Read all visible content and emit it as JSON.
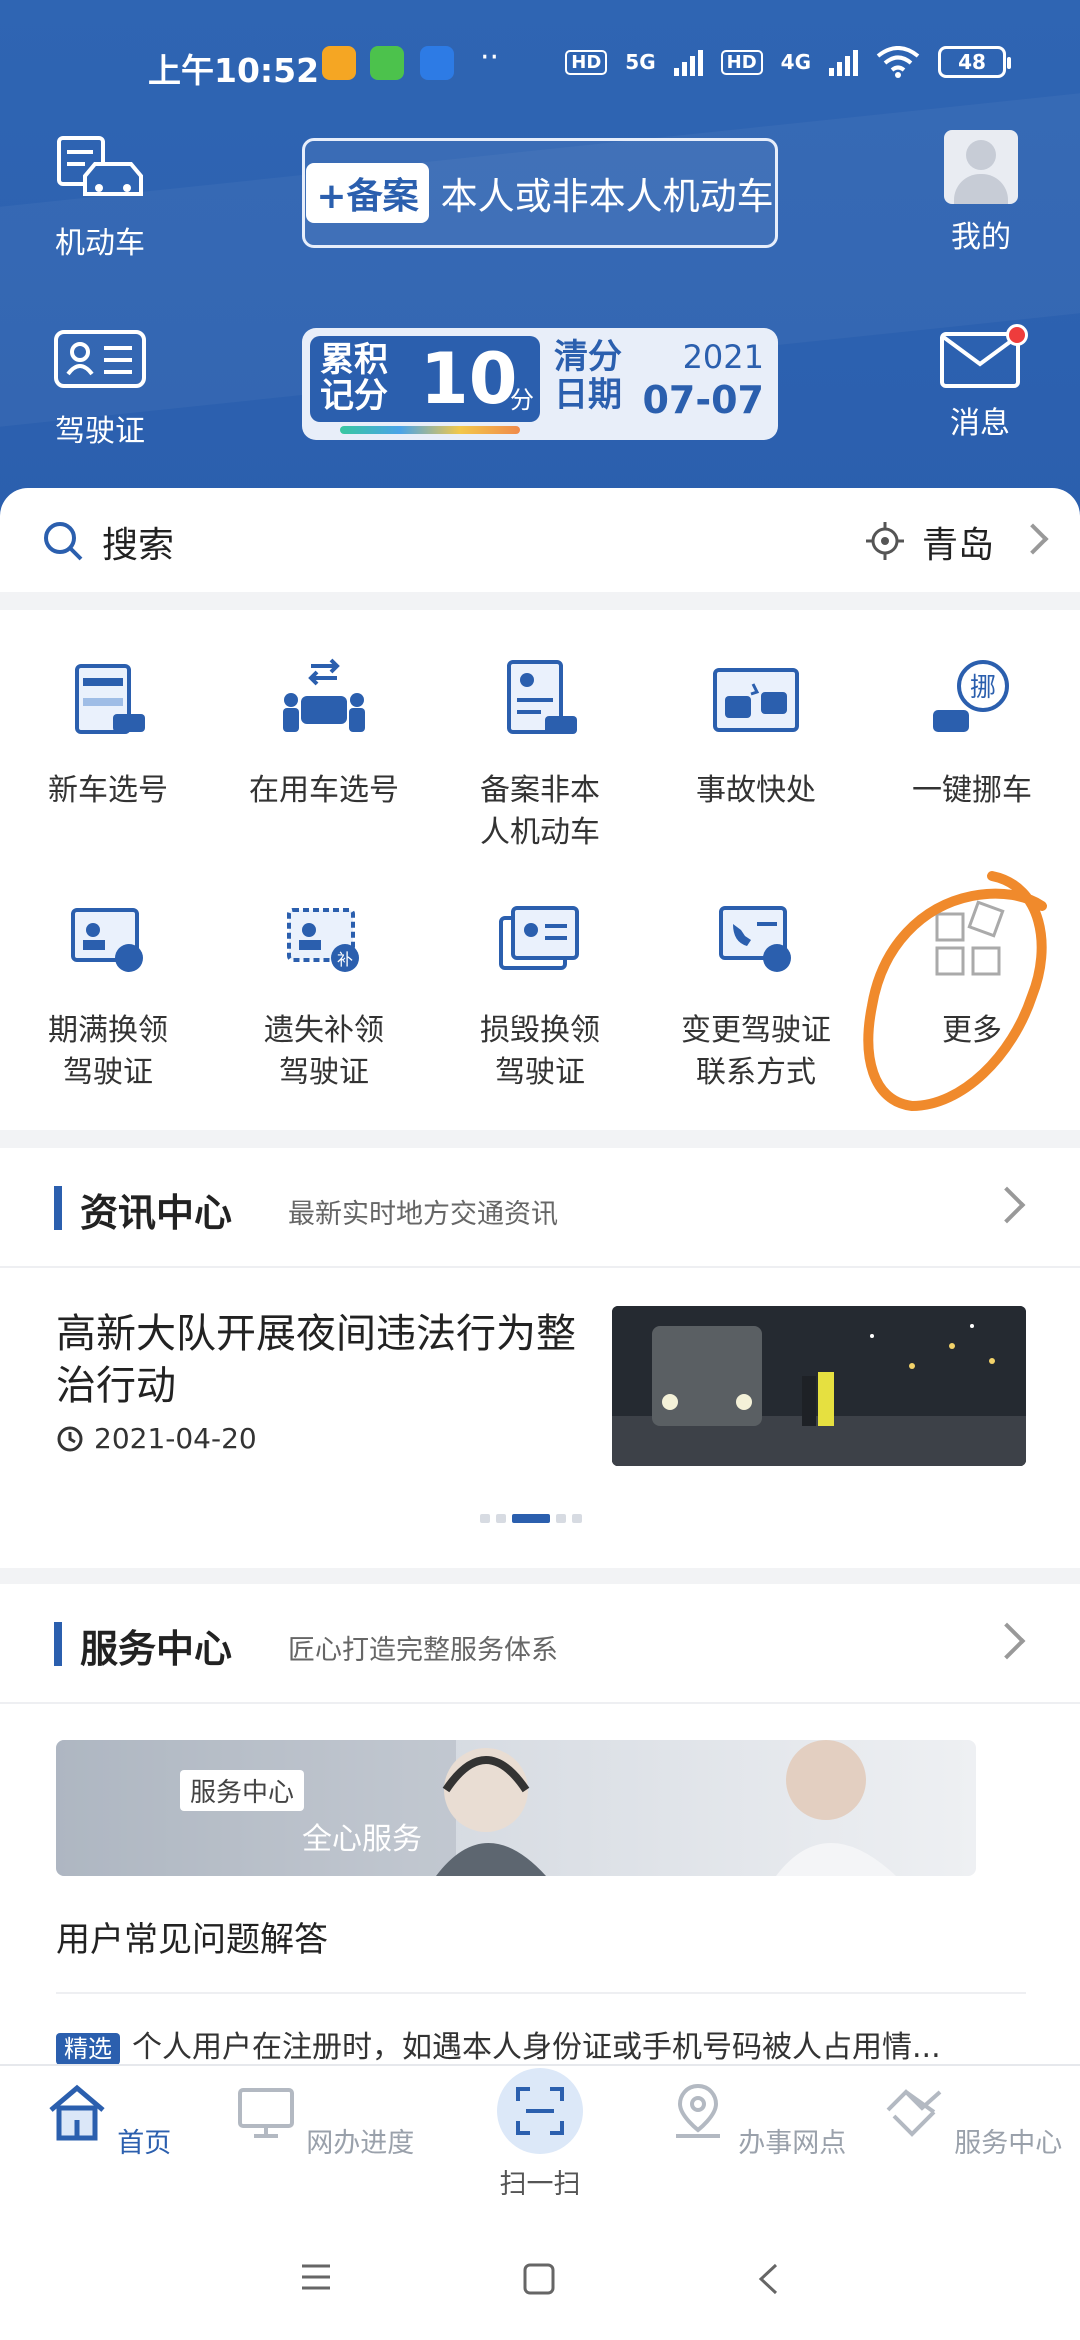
{
  "status_bar": {
    "time": "上午10:52",
    "network1": "5G",
    "network2": "4G",
    "hd1": "HD",
    "hd2": "HD",
    "battery": "48"
  },
  "header": {
    "vehicle_label": "机动车",
    "license_label": "驾驶证",
    "profile_label": "我的",
    "message_label": "消息",
    "register_tag": "+备案",
    "register_text": "本人或非本人机动车",
    "points_label": "累积记分",
    "points_value": "10",
    "points_unit": "分",
    "clear_label": "清分日期",
    "clear_year": "2021",
    "clear_date": "07-07"
  },
  "search": {
    "label": "搜索",
    "city": "青岛"
  },
  "services": [
    {
      "label": "新车选号"
    },
    {
      "label": "在用车选号"
    },
    {
      "label": "备案非本\n人机动车"
    },
    {
      "label": "事故快处"
    },
    {
      "label": "一键挪车"
    },
    {
      "label": "期满换领\n驾驶证"
    },
    {
      "label": "遗失补领\n驾驶证"
    },
    {
      "label": "损毁换领\n驾驶证"
    },
    {
      "label": "变更驾驶证\n联系方式"
    },
    {
      "label": "更多"
    }
  ],
  "news": {
    "title": "资讯中心",
    "subtitle": "最新实时地方交通资讯",
    "item_title": "高新大队开展夜间违法行为整治行动",
    "item_date": "2021-04-20"
  },
  "service_center": {
    "title": "服务中心",
    "subtitle": "匠心打造完整服务体系",
    "banner_tag": "服务中心",
    "banner_text": "全心服务",
    "faq_title": "用户常见问题解答",
    "faq_badge": "精选",
    "faq_item": "个人用户在注册时，如遇本人身份证或手机号码被人占用情..."
  },
  "tabs": [
    {
      "label": "首页",
      "active": true
    },
    {
      "label": "网办进度"
    },
    {
      "label": "扫一扫"
    },
    {
      "label": "办事网点"
    },
    {
      "label": "服务中心"
    }
  ],
  "colors": {
    "primary": "#2b5fae",
    "annotation": "#f08a2c"
  }
}
